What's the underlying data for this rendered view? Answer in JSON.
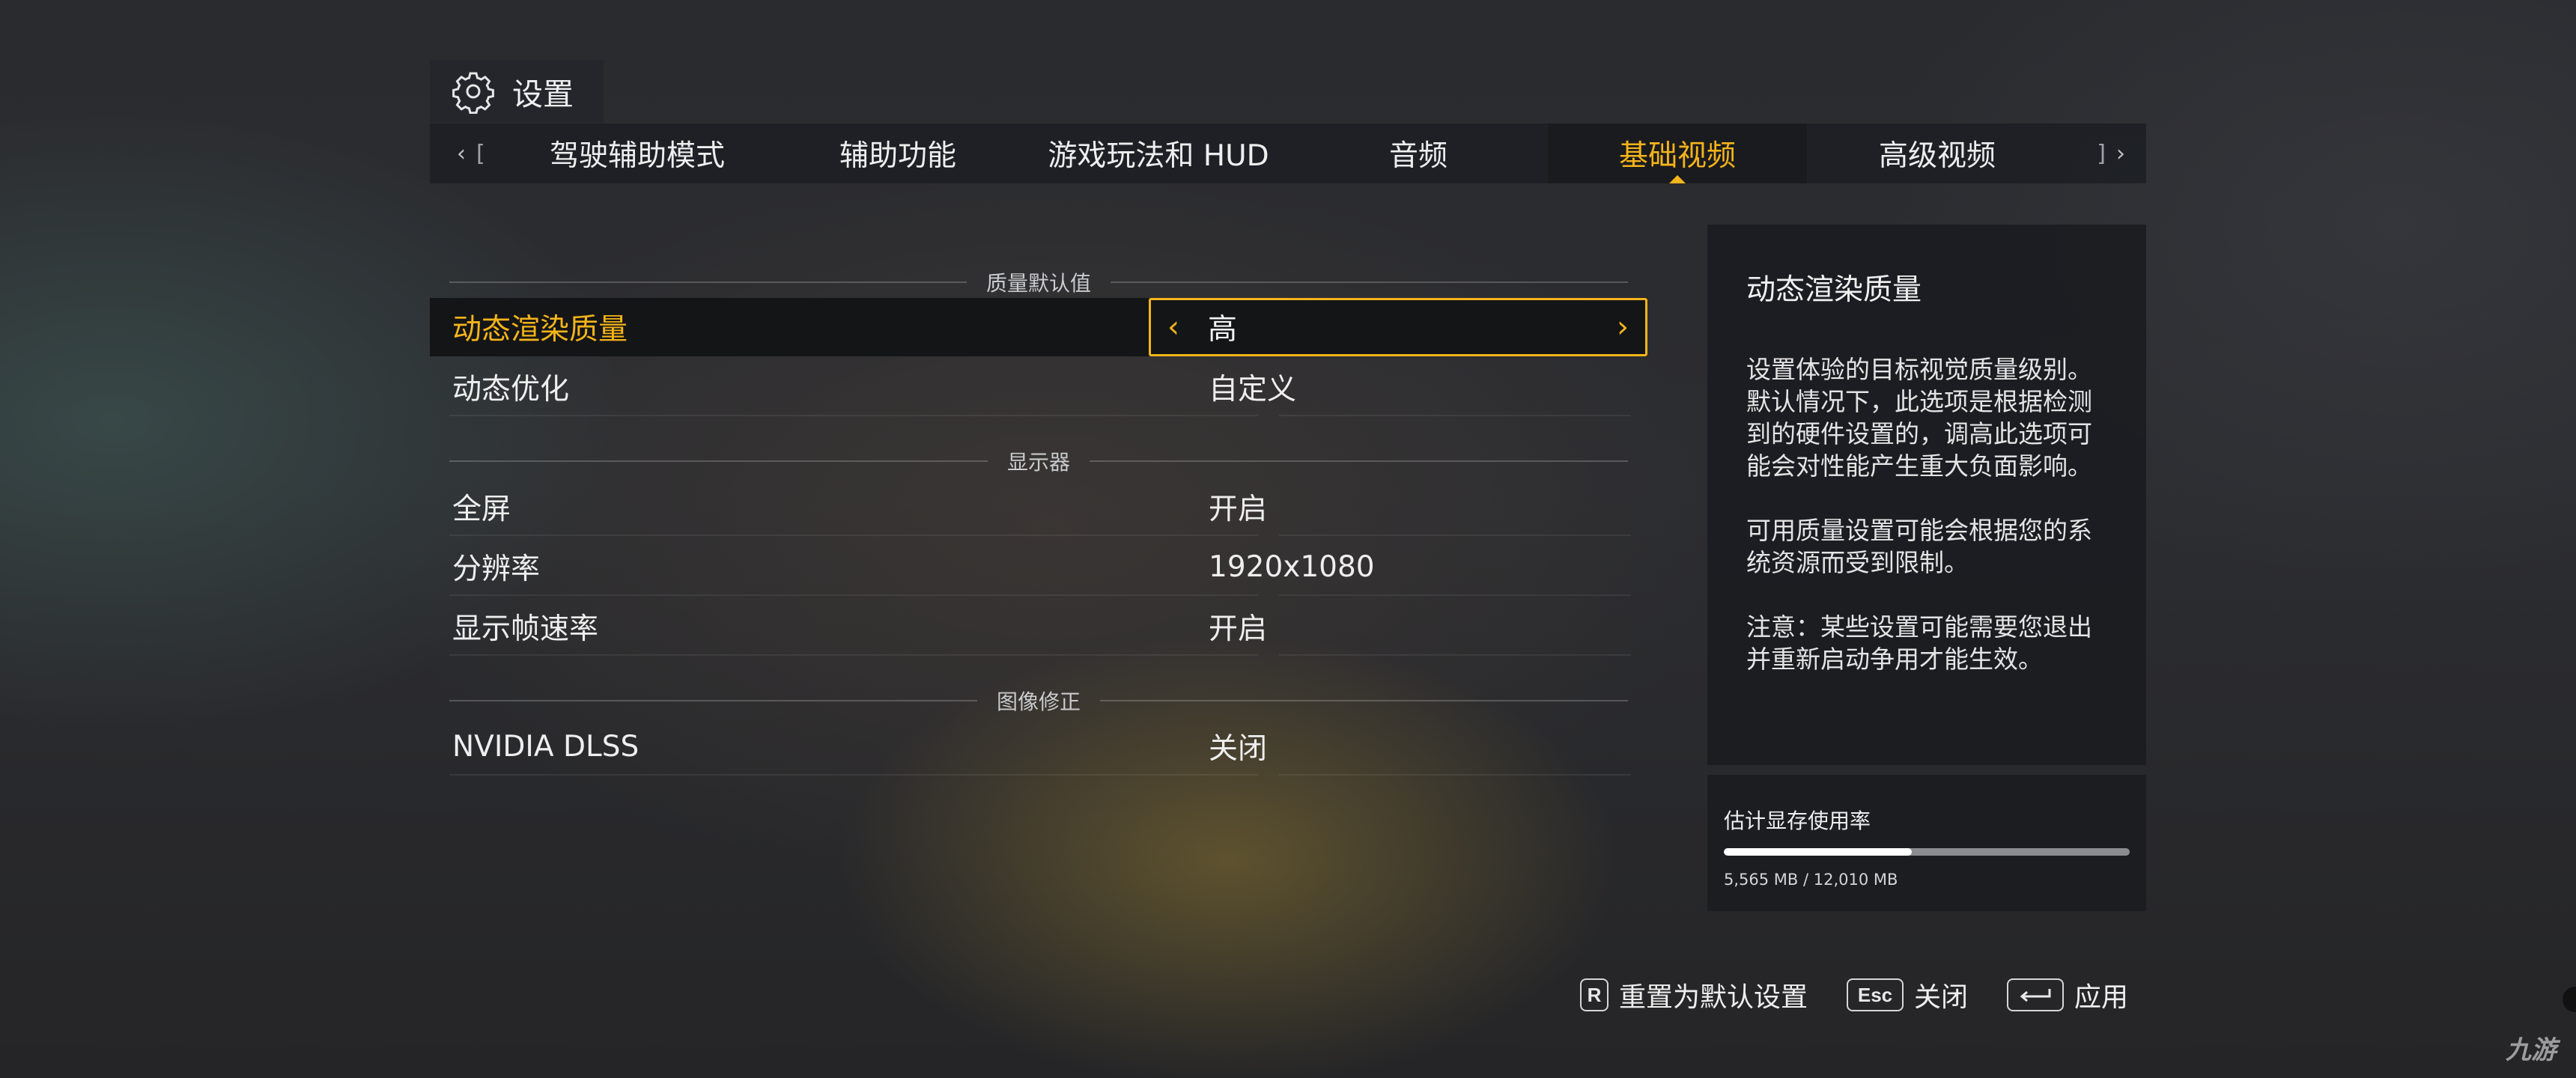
{
  "header": {
    "icon": "gear-icon",
    "title": "设置"
  },
  "tabs": {
    "prev_glyph": "‹",
    "prev_bracket": "[",
    "next_bracket": "]",
    "next_glyph": "›",
    "items": [
      {
        "label": "驾驶辅助模式",
        "active": false
      },
      {
        "label": "辅助功能",
        "active": false
      },
      {
        "label": "游戏玩法和 HUD",
        "active": false
      },
      {
        "label": "音频",
        "active": false
      },
      {
        "label": "基础视频",
        "active": true
      },
      {
        "label": "高级视频",
        "active": false
      }
    ]
  },
  "sections": [
    {
      "title": "质量默认值",
      "rows": [
        {
          "label": "动态渲染质量",
          "value": "高",
          "selected": true
        },
        {
          "label": "动态优化",
          "value": "自定义"
        }
      ]
    },
    {
      "title": "显示器",
      "rows": [
        {
          "label": "全屏",
          "value": "开启"
        },
        {
          "label": "分辨率",
          "value": "1920x1080"
        },
        {
          "label": "显示帧速率",
          "value": "开启"
        }
      ]
    },
    {
      "title": "图像修正",
      "rows": [
        {
          "label": "NVIDIA DLSS",
          "value": "关闭"
        }
      ]
    }
  ],
  "selector": {
    "left_arrow": "‹",
    "right_arrow": "›"
  },
  "info": {
    "title": "动态渲染质量",
    "paragraphs": [
      "设置体验的目标视觉质量级别。默认情况下，此选项是根据检测到的硬件设置的，调高此选项可能会对性能产生重大负面影响。",
      "可用质量设置可能会根据您的系统资源而受到限制。",
      "注意：某些设置可能需要您退出并重新启动争用才能生效。"
    ]
  },
  "vram": {
    "label": "估计显存使用率",
    "used_mb": 5565,
    "total_mb": 12010,
    "readout": "5,565 MB / 12,010 MB"
  },
  "footer": {
    "reset_key": "R",
    "reset_label": "重置为默认设置",
    "close_key": "Esc",
    "close_label": "关闭",
    "apply_key_icon": "enter-key-icon",
    "apply_label": "应用"
  },
  "watermark": "九游",
  "colors": {
    "accent": "#f4b41a",
    "text": "#eeeeee"
  }
}
